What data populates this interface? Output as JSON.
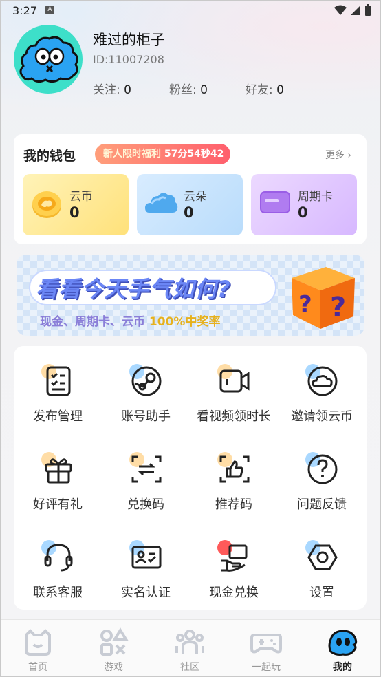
{
  "status_bar": {
    "time": "3:27",
    "badge": "A"
  },
  "profile": {
    "nickname": "难过的柜子",
    "user_id": "ID:11007208",
    "stats": [
      {
        "label": "关注:",
        "value": "0"
      },
      {
        "label": "粉丝:",
        "value": "0"
      },
      {
        "label": "好友:",
        "value": "0"
      }
    ]
  },
  "wallet": {
    "title": "我的钱包",
    "promo_prefix": "新人限时福利",
    "promo_countdown": "57分54秒42",
    "more": "更多 ›",
    "cards": [
      {
        "label": "云币",
        "value": "0",
        "icon": "coin-icon"
      },
      {
        "label": "云朵",
        "value": "0",
        "icon": "cloud-icon"
      },
      {
        "label": "周期卡",
        "value": "0",
        "icon": "card-icon"
      }
    ]
  },
  "banner": {
    "title": "看看今天手气如何?",
    "subtitle": "现金、周期卡、云币",
    "subtitle_highlight": "100%中奖率"
  },
  "menu": [
    {
      "label": "发布管理",
      "icon": "checklist-icon"
    },
    {
      "label": "账号助手",
      "icon": "steam-icon"
    },
    {
      "label": "看视频领时长",
      "icon": "video-camera-icon"
    },
    {
      "label": "邀请领云币",
      "icon": "invite-cloud-icon"
    },
    {
      "label": "好评有礼",
      "icon": "gift-icon"
    },
    {
      "label": "兑换码",
      "icon": "exchange-code-icon"
    },
    {
      "label": "推荐码",
      "icon": "thumbs-up-icon"
    },
    {
      "label": "问题反馈",
      "icon": "question-icon"
    },
    {
      "label": "联系客服",
      "icon": "headset-icon"
    },
    {
      "label": "实名认证",
      "icon": "id-card-icon"
    },
    {
      "label": "现金兑换",
      "icon": "cash-exchange-icon"
    },
    {
      "label": "设置",
      "icon": "settings-hexagon-icon"
    }
  ],
  "tabs": [
    {
      "label": "首页",
      "icon": "home-icon"
    },
    {
      "label": "游戏",
      "icon": "games-icon"
    },
    {
      "label": "社区",
      "icon": "community-icon"
    },
    {
      "label": "一起玩",
      "icon": "gamepad-icon"
    },
    {
      "label": "我的",
      "icon": "mascot-icon",
      "active": true
    }
  ],
  "colors": {
    "avatar_bg": "#3ddfc9",
    "mascot_blue": "#2aa3f2",
    "promo_start": "#ff9e7a",
    "promo_end": "#ff5f6d"
  }
}
